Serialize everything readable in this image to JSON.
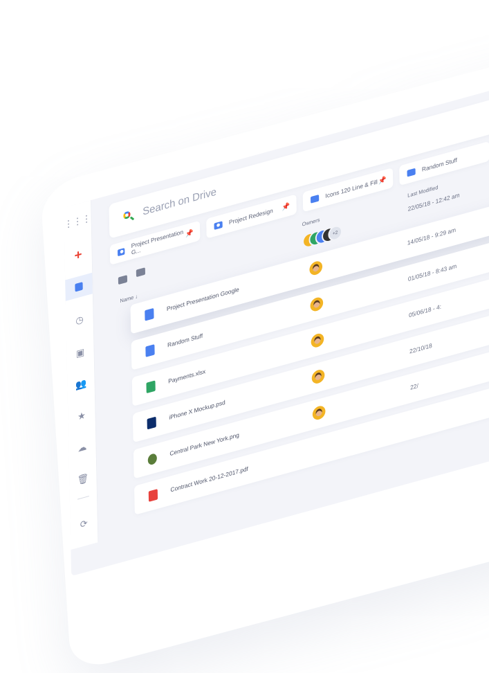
{
  "search": {
    "placeholder": "Search on Drive"
  },
  "chips": [
    {
      "label": "Project Presentation G...",
      "pin_color": "#e8423d"
    },
    {
      "label": "Project Redesign",
      "pin_color": "#f3b425"
    },
    {
      "label": "Icons 120 Line & Fill",
      "pin_color": "#2fa564"
    },
    {
      "label": "Random Stuff",
      "pin_color": ""
    }
  ],
  "table": {
    "col_name": "Name ↓",
    "col_owners": "Owners",
    "col_modified": "Last Modified",
    "shared_more": "+2",
    "rows": [
      {
        "name": "",
        "modified": "22/05/18 - 12:42 am"
      },
      {
        "name": "Project Presentation Google",
        "modified": "14/05/18 - 9:29 am"
      },
      {
        "name": "Random Stuff",
        "modified": "01/05/18 - 8:43 am"
      },
      {
        "name": "Payments.xlsx",
        "modified": "05/06/18 - 4:"
      },
      {
        "name": "iPhone X Mockup.psd",
        "modified": "22/10/18"
      },
      {
        "name": "Central Park New York.png",
        "modified": "22/"
      },
      {
        "name": "Contract Work 20-12-2017.pdf",
        "modified": ""
      }
    ]
  },
  "colors": {
    "accent": "#4a80f0",
    "background": "#f3f4f9"
  }
}
